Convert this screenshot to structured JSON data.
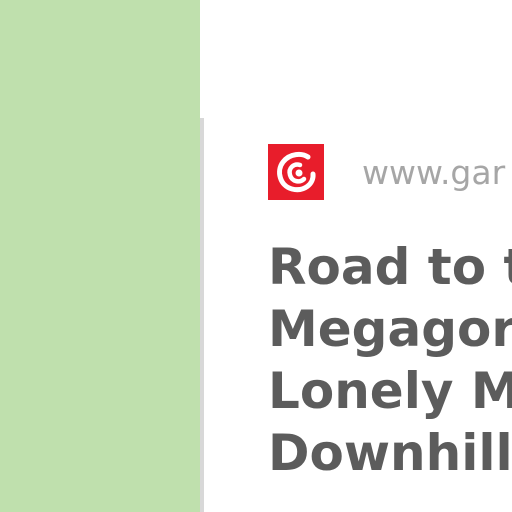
{
  "sidebar": {
    "color": "#bfe0ad"
  },
  "card": {
    "logo_icon": "gamespot-swirl-icon",
    "logo_color": "#e81d2b",
    "site_url": "www.gar",
    "title_lines": [
      "Road to t",
      "Megagor",
      "Lonely M",
      "Downhill"
    ]
  }
}
